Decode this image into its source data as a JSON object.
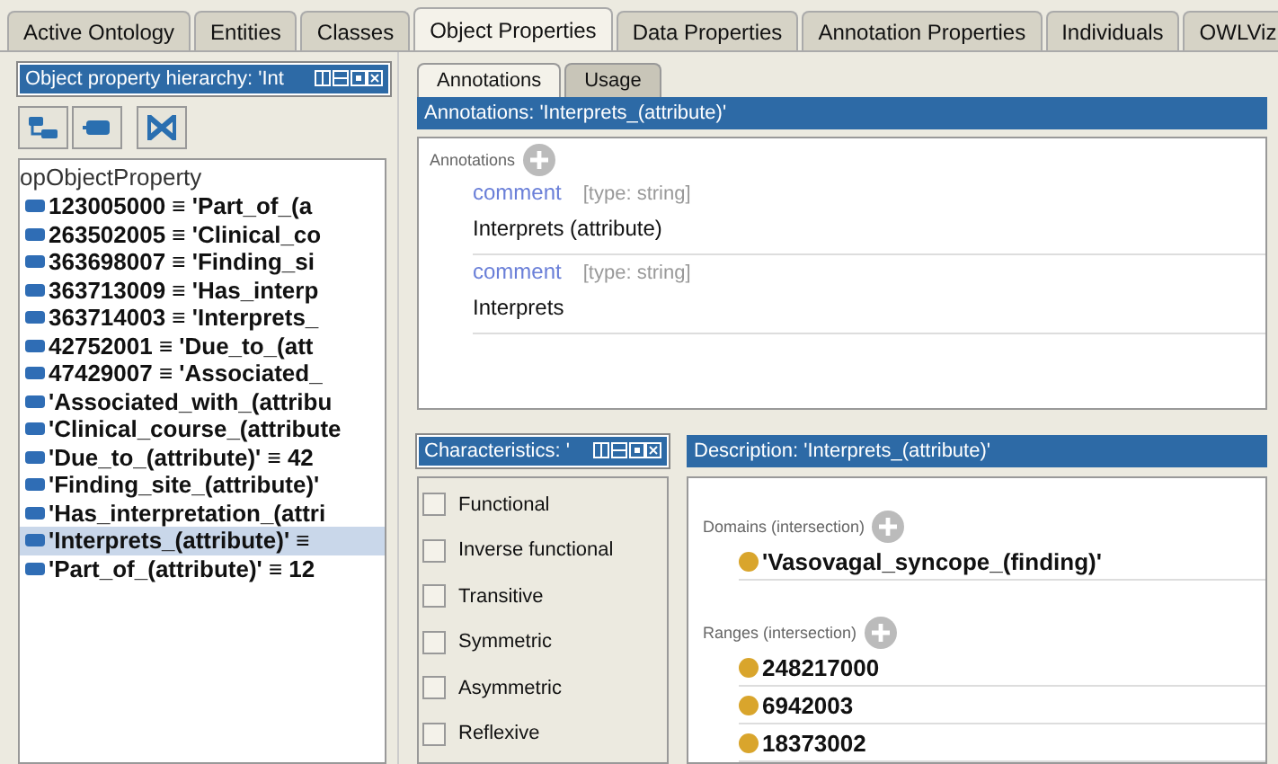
{
  "tabs": [
    {
      "label": "Active Ontology",
      "selected": false
    },
    {
      "label": "Entities",
      "selected": false
    },
    {
      "label": "Classes",
      "selected": false
    },
    {
      "label": "Object Properties",
      "selected": true
    },
    {
      "label": "Data Properties",
      "selected": false
    },
    {
      "label": "Annotation Properties",
      "selected": false
    },
    {
      "label": "Individuals",
      "selected": false
    },
    {
      "label": "OWLViz",
      "selected": false
    }
  ],
  "hierarchy": {
    "title": "Object property hierarchy: 'Int",
    "root": "opObjectProperty",
    "items": [
      {
        "label": "123005000 ≡ 'Part_of_(a",
        "selected": false
      },
      {
        "label": "263502005 ≡ 'Clinical_co",
        "selected": false
      },
      {
        "label": "363698007 ≡ 'Finding_si",
        "selected": false
      },
      {
        "label": "363713009 ≡ 'Has_interp",
        "selected": false
      },
      {
        "label": "363714003 ≡ 'Interprets_",
        "selected": false
      },
      {
        "label": "42752001 ≡ 'Due_to_(att",
        "selected": false
      },
      {
        "label": "47429007 ≡ 'Associated_",
        "selected": false
      },
      {
        "label": "'Associated_with_(attribu",
        "selected": false
      },
      {
        "label": "'Clinical_course_(attribute",
        "selected": false
      },
      {
        "label": "'Due_to_(attribute)' ≡ 42",
        "selected": false
      },
      {
        "label": "'Finding_site_(attribute)'",
        "selected": false
      },
      {
        "label": "'Has_interpretation_(attri",
        "selected": false
      },
      {
        "label": "'Interprets_(attribute)' ≡",
        "selected": true
      },
      {
        "label": "'Part_of_(attribute)' ≡ 12",
        "selected": false
      }
    ]
  },
  "detail_tabs": [
    {
      "label": "Annotations",
      "selected": true
    },
    {
      "label": "Usage",
      "selected": false
    }
  ],
  "annotations": {
    "title": "Annotations: 'Interprets_(attribute)'",
    "section": "Annotations",
    "entries": [
      {
        "property": "comment",
        "type": "[type: string]",
        "value": "Interprets (attribute)"
      },
      {
        "property": "comment",
        "type": "[type: string]",
        "value": "Interprets"
      }
    ]
  },
  "characteristics": {
    "title": "Characteristics: '",
    "items": [
      {
        "label": "Functional",
        "checked": false
      },
      {
        "label": "Inverse functional",
        "checked": false
      },
      {
        "label": "Transitive",
        "checked": false
      },
      {
        "label": "Symmetric",
        "checked": false
      },
      {
        "label": "Asymmetric",
        "checked": false
      },
      {
        "label": "Reflexive",
        "checked": false
      }
    ]
  },
  "description": {
    "title": "Description: 'Interprets_(attribute)'",
    "domains_label": "Domains (intersection)",
    "domains": [
      "'Vasovagal_syncope_(finding)'"
    ],
    "ranges_label": "Ranges (intersection)",
    "ranges": [
      "248217000",
      "6942003",
      "18373002"
    ]
  }
}
